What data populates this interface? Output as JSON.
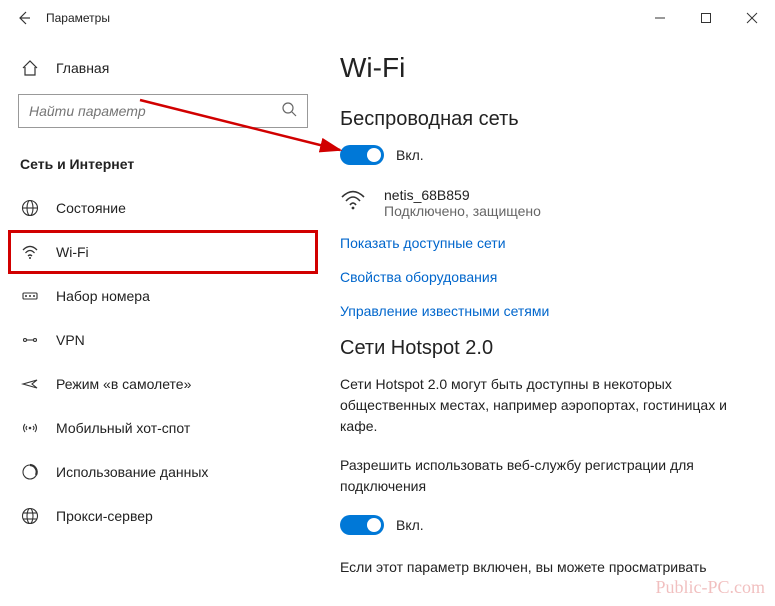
{
  "titlebar": {
    "title": "Параметры"
  },
  "sidebar": {
    "home": "Главная",
    "search_placeholder": "Найти параметр",
    "section": "Сеть и Интернет",
    "items": [
      {
        "label": "Состояние"
      },
      {
        "label": "Wi-Fi"
      },
      {
        "label": "Набор номера"
      },
      {
        "label": "VPN"
      },
      {
        "label": "Режим «в самолете»"
      },
      {
        "label": "Мобильный хот-спот"
      },
      {
        "label": "Использование данных"
      },
      {
        "label": "Прокси-сервер"
      }
    ]
  },
  "content": {
    "page_title": "Wi-Fi",
    "wireless_section": "Беспроводная сеть",
    "toggle1_label": "Вкл.",
    "ssid": "netis_68B859",
    "conn_status": "Подключено, защищено",
    "link_show_networks": "Показать доступные сети",
    "link_hw_props": "Свойства оборудования",
    "link_known_networks": "Управление известными сетями",
    "hotspot_section": "Сети Hotspot 2.0",
    "hotspot_body": "Сети Hotspot 2.0 могут быть доступны в некоторых общественных местах, например аэропортах, гостиницах и кафе.",
    "hotspot_allow": "Разрешить использовать веб-службу регистрации для подключения",
    "toggle2_label": "Вкл.",
    "footer_text": "Если этот параметр включен, вы можете просматривать"
  },
  "watermark": "Public-PC.com"
}
